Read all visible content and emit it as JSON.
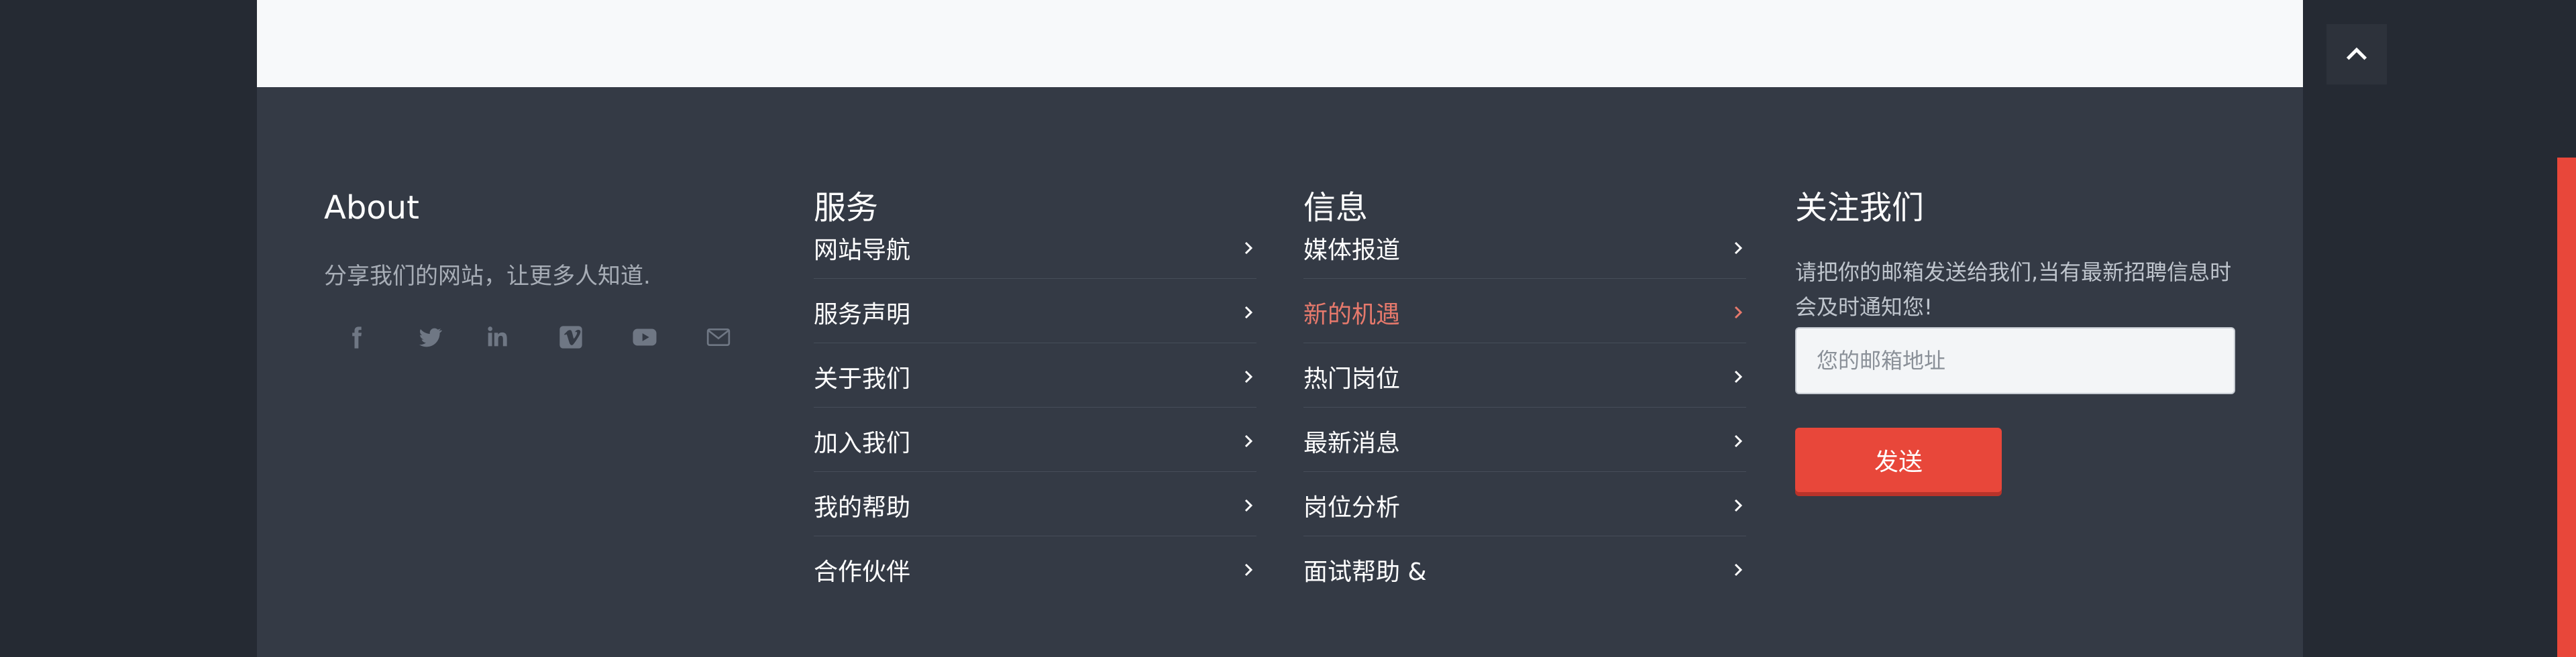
{
  "about": {
    "title": "About",
    "text": "分享我们的网站，让更多人知道.",
    "social": [
      "facebook-icon",
      "twitter-icon",
      "linkedin-icon",
      "vimeo-icon",
      "youtube-icon",
      "mail-icon"
    ]
  },
  "service": {
    "title": "服务",
    "links": [
      "网站导航",
      "服务声明",
      "关于我们",
      "加入我们",
      "我的帮助",
      "合作伙伴"
    ]
  },
  "info": {
    "title": "信息",
    "links": [
      "媒体报道",
      "新的机遇",
      "热门岗位",
      "最新消息",
      "岗位分析",
      "面试帮助 &"
    ],
    "active_index": 1
  },
  "follow": {
    "title": "关注我们",
    "text": "请把你的邮箱发送给我们,当有最新招聘信息时会及时通知您!",
    "email_placeholder": "您的邮箱地址",
    "send_label": "发送"
  },
  "colors": {
    "accent": "#e8473a",
    "footer_bg": "#343a45",
    "page_bg": "#252a33"
  }
}
